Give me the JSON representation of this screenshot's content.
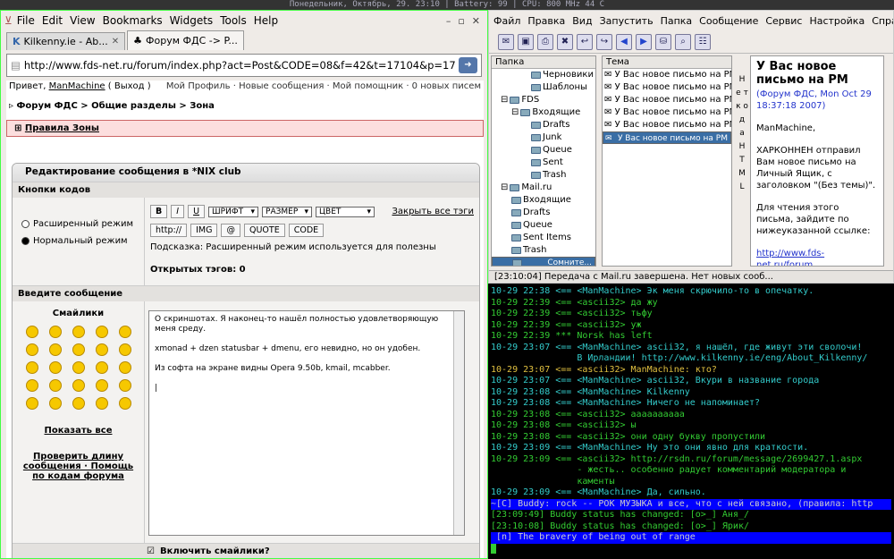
{
  "status_bar": "Понедельник, Октябрь, 29. 23:10 | Battery: 99 | CPU: 800 MHz 44 C",
  "browser": {
    "menu": [
      "File",
      "Edit",
      "View",
      "Bookmarks",
      "Widgets",
      "Tools",
      "Help"
    ],
    "tabs": [
      "Kilkenny.ie - Ab...",
      "Форум ФДС -> P..."
    ],
    "url": "http://www.fds-net.ru/forum/index.php?act=Post&CODE=08&f=42&t=17104&p=17717",
    "greeting": "Привет,",
    "user": "ManMachine",
    "logout": "( Выход )",
    "links": "Мой Профиль · Новые сообщения · Мой помощник · 0 новых писем",
    "breadcrumb": "▹ Форум ФДС > Общие разделы > Зона",
    "rules": "Правила Зоны",
    "edit_title": "Редактирование сообщения в *NIX club",
    "codes_label": "Кнопки кодов",
    "mode_ext": "Расширенный режим",
    "mode_norm": "Нормальный режим",
    "btn_b": "B",
    "btn_i": "I",
    "btn_u": "U",
    "font_sel": "ШРИФТ",
    "size_sel": "РАЗМЕР",
    "color_sel": "ЦВЕТ",
    "close_tags": "Закрыть все тэги",
    "btn_http": "http://",
    "btn_img": "IMG",
    "btn_at": "@",
    "btn_quote": "QUOTE",
    "btn_code": "CODE",
    "hint": "Подсказка: Расширенный режим используется для полезны",
    "open_tags": "Открытых тэгов:  0",
    "enter_msg": "Введите сообщение",
    "smileys_label": "Смайлики",
    "show_all": "Показать все",
    "check_len": "Проверить длину сообщения · Помощь по кодам форума",
    "text": [
      "О скриншотах. Я наконец-то нашёл полностью удовлетворяющую меня среду.",
      "xmonad + dzen statusbar + dmenu, его невидно, но он удобен.",
      "Из софта на экране видны Opera 9.50b, kmail, mcabber."
    ],
    "enable_smileys": "Включить смайлики?"
  },
  "mail": {
    "menu": [
      "Файл",
      "Правка",
      "Вид",
      "Запустить",
      "Папка",
      "Сообщение",
      "Сервис",
      "Настройка",
      "Справка"
    ],
    "folders_header": "Папка",
    "folders": [
      "Черновики",
      "Шаблоны",
      "FDS",
      "Входящие",
      "Drafts",
      "Junk",
      "Queue",
      "Sent",
      "Trash",
      "Mail.ru",
      "Входящие",
      "Drafts",
      "Queue",
      "Sent Items",
      "Trash",
      "Сомните..."
    ],
    "list_header": "Тема",
    "messages": [
      "У Вас новое письмо на РМ",
      "У Вас новое письмо на РМ",
      "У Вас новое письмо на РМ",
      "У Вас новое письмо на РМ",
      "У Вас новое письмо на РМ",
      "У Вас новое письмо на РМ"
    ],
    "vertical": "Н е т   к о д а   H T M L",
    "preview_title": "У Вас новое письмо на РМ",
    "preview_meta": "(Форум ФДС, Mon Oct 29 18:37:18 2007)",
    "preview_body1": "ManMachine,",
    "preview_body2": "ХАРКОННЕН отправил Вам новое письмо на Личный Ящик, с заголовком \"(Без темы)\".",
    "preview_body3": "Для чтения этого письма, зайдите по нижеуказанной ссылке:",
    "preview_link": "http://www.fds-net.ru/forum",
    "status": "[23:10:04] Передача с Mail.ru завершена. Нет новых сооб..."
  },
  "terminal": [
    {
      "c": "t-me",
      "t": "10-29 22:38 <== <ManMachine> Эк меня скрючило-то в опечатку."
    },
    {
      "c": "t-ascii",
      "t": "10-29 22:39 <== <ascii32> да жу"
    },
    {
      "c": "t-ascii",
      "t": "10-29 22:39 <== <ascii32> тьфу"
    },
    {
      "c": "t-ascii",
      "t": "10-29 22:39 <== <ascii32> уж"
    },
    {
      "c": "t-ascii",
      "t": "10-29 22:39 *** Norsk has left"
    },
    {
      "c": "t-me",
      "t": "10-29 23:07 <== <ManMachine> ascii32, я нашёл, где живут эти сволочи!"
    },
    {
      "c": "t-me",
      "t": "                В Ирландии! http://www.kilkenny.ie/eng/About_Kilkenny/"
    },
    {
      "c": "t-hl",
      "t": "10-29 23:07 <== <ascii32> ManMachine: кто?"
    },
    {
      "c": "t-me",
      "t": "10-29 23:07 <== <ManMachine> ascii32, Вкури в название города"
    },
    {
      "c": "t-me",
      "t": "10-29 23:08 <== <ManMachine> Kilkenny"
    },
    {
      "c": "t-me",
      "t": "10-29 23:08 <== <ManMachine> Ничего не напоминает?"
    },
    {
      "c": "t-ascii",
      "t": "10-29 23:08 <== <ascii32> аааааааааа"
    },
    {
      "c": "t-ascii",
      "t": "10-29 23:08 <== <ascii32> ы"
    },
    {
      "c": "t-ascii",
      "t": "10-29 23:08 <== <ascii32> они одну букву пропустили"
    },
    {
      "c": "t-me",
      "t": "10-29 23:09 <== <ManMachine> Ну это они явно для краткости."
    },
    {
      "c": "t-ascii",
      "t": "10-29 23:09 <== <ascii32> http://rsdn.ru/forum/message/2699427.1.aspx"
    },
    {
      "c": "t-ascii",
      "t": "                - жесть.. особенно радует комментарий модератора и"
    },
    {
      "c": "t-ascii",
      "t": "                каменты"
    },
    {
      "c": "t-me",
      "t": "10-29 23:09 <== <ManMachine> Да, сильно."
    },
    {
      "c": "t-buddy",
      "t": "~[C] Buddy: rock -- РОК МУЗЫКА и все, что с ней связано, (правила: http"
    },
    {
      "c": "t-ascii",
      "t": "[23:09:49] Buddy status has changed: [o>_] Аня_/"
    },
    {
      "c": "t-ascii",
      "t": "[23:10:08] Buddy status has changed: [o>_] Ярик/"
    },
    {
      "c": "t-buddy",
      "t": " [n] The bravery of being out of range"
    }
  ]
}
